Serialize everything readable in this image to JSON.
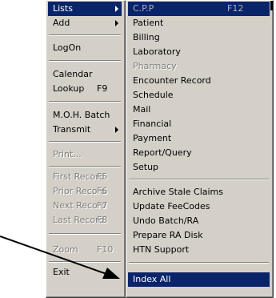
{
  "left_menu": {
    "items": [
      {
        "label": "Lists",
        "shortcut": "",
        "submenu": true,
        "selected": true,
        "disabled": false
      },
      {
        "label": "Add",
        "shortcut": "",
        "submenu": true,
        "selected": false,
        "disabled": false
      },
      {
        "label": "LogOn",
        "shortcut": "",
        "submenu": false,
        "selected": false,
        "disabled": false
      },
      {
        "label": "Calendar",
        "shortcut": "",
        "submenu": false,
        "selected": false,
        "disabled": false
      },
      {
        "label": "Lookup",
        "shortcut": "F9",
        "submenu": false,
        "selected": false,
        "disabled": false
      },
      {
        "label": "M.O.H. Batch",
        "shortcut": "",
        "submenu": false,
        "selected": false,
        "disabled": false
      },
      {
        "label": "Transmit",
        "shortcut": "",
        "submenu": true,
        "selected": false,
        "disabled": false
      },
      {
        "label": "Print...",
        "shortcut": "",
        "submenu": false,
        "selected": false,
        "disabled": true
      },
      {
        "label": "First Record",
        "shortcut": "F5",
        "submenu": false,
        "selected": false,
        "disabled": true
      },
      {
        "label": "Prior Record",
        "shortcut": "F6",
        "submenu": false,
        "selected": false,
        "disabled": true
      },
      {
        "label": "Next Record",
        "shortcut": "F7",
        "submenu": false,
        "selected": false,
        "disabled": true
      },
      {
        "label": "Last Record",
        "shortcut": "F8",
        "submenu": false,
        "selected": false,
        "disabled": true
      },
      {
        "label": "Zoom",
        "shortcut": "F10",
        "submenu": false,
        "selected": false,
        "disabled": true
      },
      {
        "label": "Exit",
        "shortcut": "",
        "submenu": false,
        "selected": false,
        "disabled": false
      }
    ]
  },
  "right_menu": {
    "items": [
      {
        "label": "C.P.P",
        "shortcut": "F12",
        "selected": true,
        "disabled": true
      },
      {
        "label": "Patient",
        "shortcut": "",
        "selected": false,
        "disabled": false
      },
      {
        "label": "Billing",
        "shortcut": "",
        "selected": false,
        "disabled": false
      },
      {
        "label": "Laboratory",
        "shortcut": "",
        "selected": false,
        "disabled": false
      },
      {
        "label": "Pharmacy",
        "shortcut": "",
        "selected": false,
        "disabled": true
      },
      {
        "label": "Encounter Record",
        "shortcut": "",
        "selected": false,
        "disabled": false
      },
      {
        "label": "Schedule",
        "shortcut": "",
        "selected": false,
        "disabled": false
      },
      {
        "label": "Mail",
        "shortcut": "",
        "selected": false,
        "disabled": false
      },
      {
        "label": "Financial",
        "shortcut": "",
        "selected": false,
        "disabled": false
      },
      {
        "label": "Payment",
        "shortcut": "",
        "selected": false,
        "disabled": false
      },
      {
        "label": "Report/Query",
        "shortcut": "",
        "selected": false,
        "disabled": false
      },
      {
        "label": "Setup",
        "shortcut": "",
        "selected": false,
        "disabled": false
      },
      {
        "label": "Archive Stale Claims",
        "shortcut": "",
        "selected": false,
        "disabled": false
      },
      {
        "label": "Update FeeCodes",
        "shortcut": "",
        "selected": false,
        "disabled": false
      },
      {
        "label": "Undo Batch/RA",
        "shortcut": "",
        "selected": false,
        "disabled": false
      },
      {
        "label": "Prepare RA Disk",
        "shortcut": "",
        "selected": false,
        "disabled": false
      },
      {
        "label": "HTN Support",
        "shortcut": "",
        "selected": false,
        "disabled": false
      },
      {
        "label": "Index All",
        "shortcut": "",
        "selected": true,
        "disabled": false
      }
    ]
  },
  "colors": {
    "menu_bg": "#d4d0c8",
    "highlight": "#0a246a",
    "disabled_text": "#808080"
  }
}
